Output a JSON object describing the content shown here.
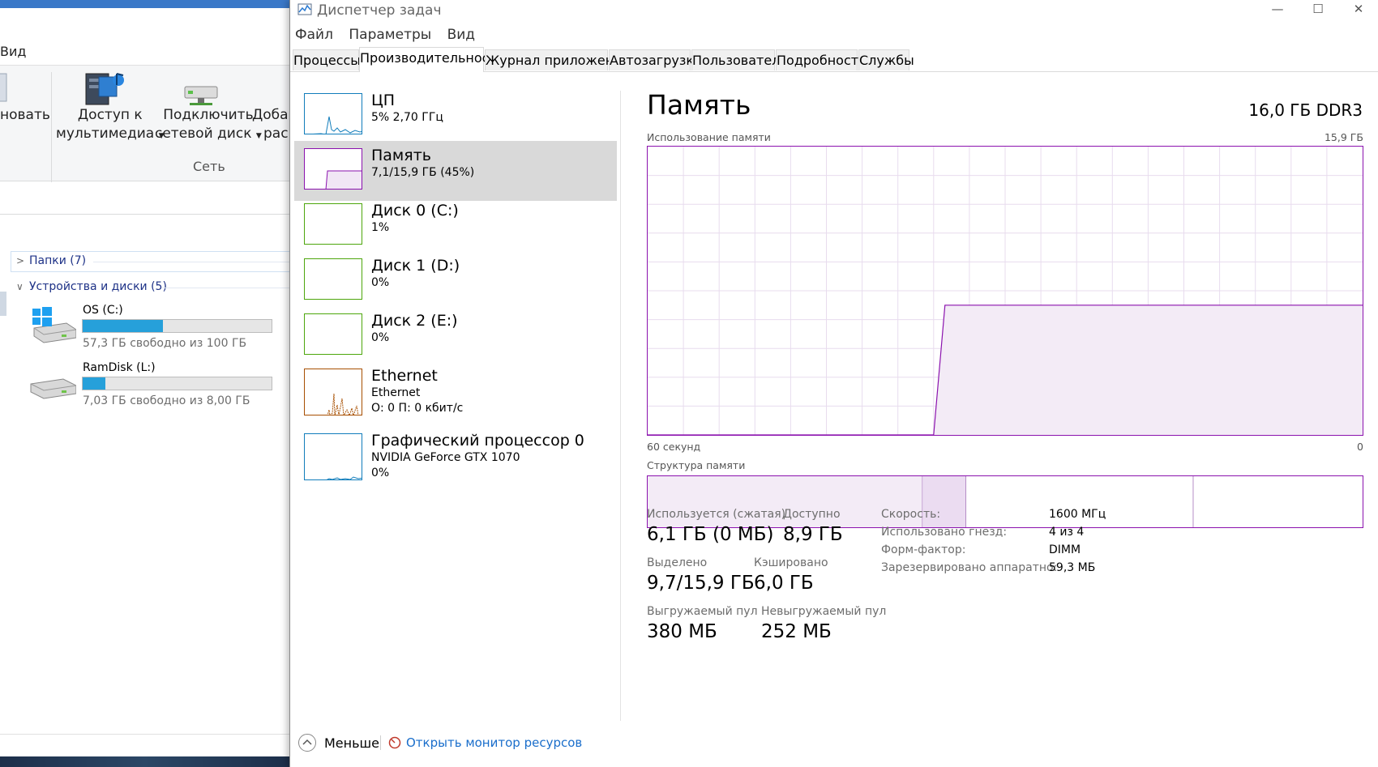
{
  "explorer": {
    "view_tab": "Вид",
    "ribbon": {
      "cut_label": "новать",
      "media_label_1": "Доступ к",
      "media_label_2": "мультимедиа",
      "netdrive_label_1": "Подключить",
      "netdrive_label_2": "сетевой диск",
      "add_label_1": "Добав",
      "add_label_2": "рас",
      "group_label": "Сеть"
    },
    "folders_group": "Папки (7)",
    "devices_group": "Устройства и диски (5)",
    "drives": [
      {
        "name": "OS (C:)",
        "free_text": "57,3 ГБ свободно из 100 ГБ",
        "used_fraction": 0.427
      },
      {
        "name": "RamDisk (L:)",
        "free_text": "7,03 ГБ свободно из 8,00 ГБ",
        "used_fraction": 0.121
      }
    ]
  },
  "taskmgr": {
    "title": "Диспетчер задач",
    "menu": [
      "Файл",
      "Параметры",
      "Вид"
    ],
    "tabs": [
      "Процессы",
      "Производительность",
      "Журнал приложений",
      "Автозагрузка",
      "Пользователи",
      "Подробности",
      "Службы"
    ],
    "active_tab": "Производительность",
    "resources": [
      {
        "name": "ЦП",
        "line1": "5% 2,70 ГГц",
        "line2": ""
      },
      {
        "name": "Память",
        "line1": "7,1/15,9 ГБ (45%)",
        "line2": ""
      },
      {
        "name": "Диск 0 (C:)",
        "line1": "1%",
        "line2": ""
      },
      {
        "name": "Диск 1 (D:)",
        "line1": "0%",
        "line2": ""
      },
      {
        "name": "Диск 2 (E:)",
        "line1": "0%",
        "line2": ""
      },
      {
        "name": "Ethernet",
        "line1": "Ethernet",
        "line2": "О: 0 П: 0 кбит/с"
      },
      {
        "name": "Графический процессор 0",
        "line1": "NVIDIA GeForce GTX 1070",
        "line2": "0%"
      }
    ],
    "memory": {
      "title": "Память",
      "total": "16,0 ГБ DDR3",
      "usage_label": "Использование памяти",
      "usage_max": "15,9 ГБ",
      "time_left": "60 секунд",
      "time_right": "0",
      "composition_label": "Структура памяти",
      "usage_history_fraction": {
        "before": 0.0,
        "after": 0.45,
        "step_at_fraction_of_window": 0.4
      },
      "composition_fractions": {
        "in_use": 0.384,
        "modified": 0.061,
        "standby": 0.318,
        "free": 0.237
      },
      "stats": {
        "in_use_label": "Используется (сжатая)",
        "in_use_value": "6,1 ГБ (0 МБ)",
        "available_label": "Доступно",
        "available_value": "8,9 ГБ",
        "committed_label": "Выделено",
        "committed_value": "9,7/15,9 ГБ",
        "cached_label": "Кэшировано",
        "cached_value": "6,0 ГБ",
        "paged_label": "Выгружаемый пул",
        "paged_value": "380 МБ",
        "nonpaged_label": "Невыгружаемый пул",
        "nonpaged_value": "252 МБ"
      },
      "details": [
        {
          "label": "Скорость:",
          "value": "1600 МГц"
        },
        {
          "label": "Использовано гнезд:",
          "value": "4 из 4"
        },
        {
          "label": "Форм-фактор:",
          "value": "DIMM"
        },
        {
          "label": "Зарезервировано аппаратно:",
          "value": "59,3 МБ"
        }
      ]
    },
    "bottom": {
      "fewer_details": "Меньше",
      "open_monitor": "Открыть монитор ресурсов"
    },
    "colors": {
      "memory": "#8b12ae",
      "cpu": "#117dbb",
      "disk": "#4da60c",
      "ethernet": "#a74f01",
      "gpu": "#117dbb",
      "link": "#1a6ecb"
    }
  }
}
